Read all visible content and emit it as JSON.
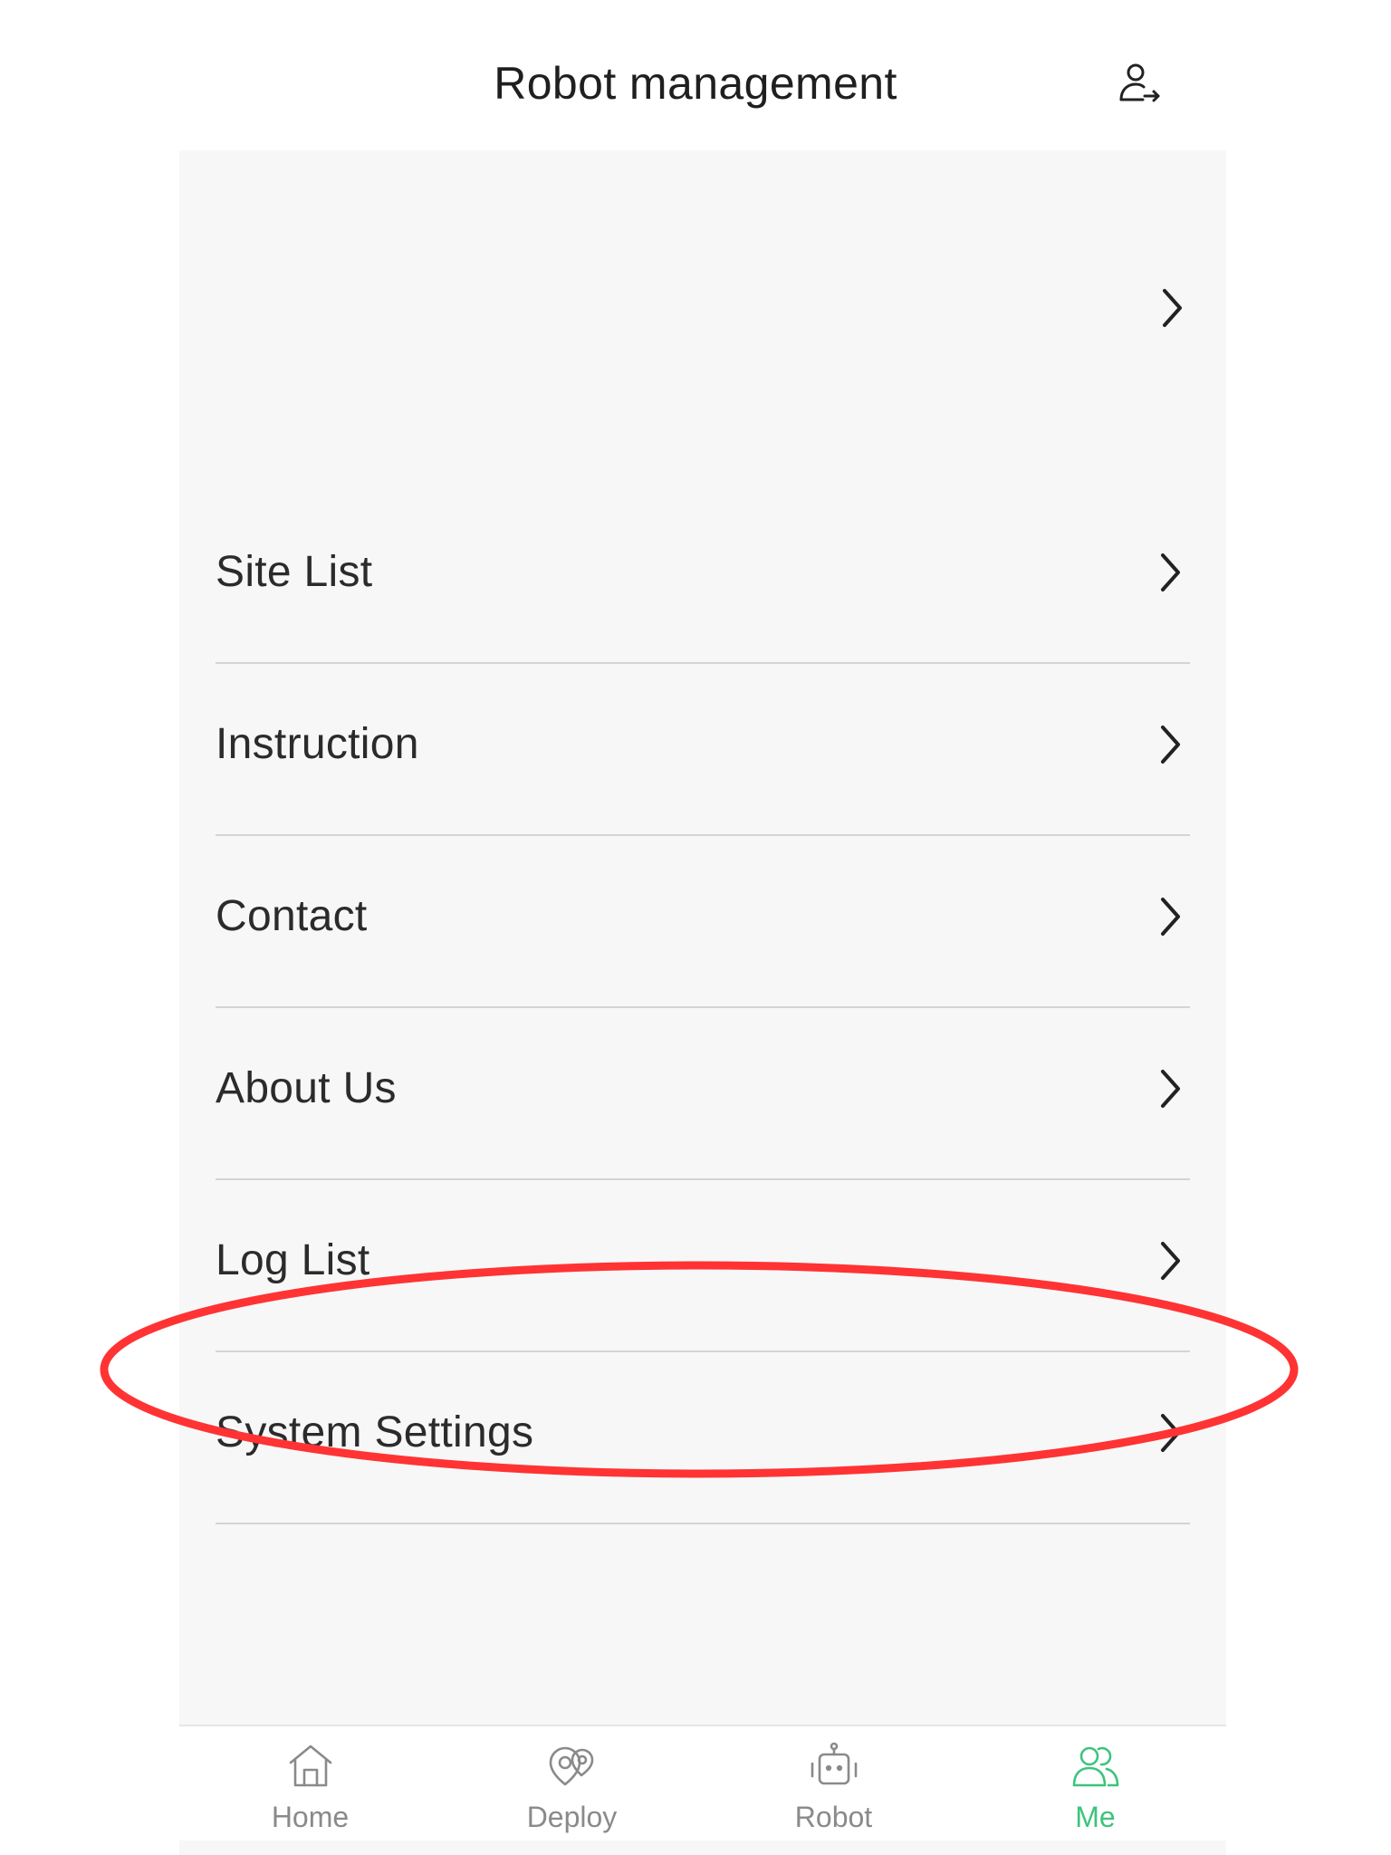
{
  "header": {
    "title": "Robot management",
    "logout_icon": "user-logout-icon"
  },
  "profile": {
    "chevron_icon": "chevron-right-icon"
  },
  "menu": {
    "items": [
      {
        "label": "Site List"
      },
      {
        "label": "Instruction"
      },
      {
        "label": "Contact"
      },
      {
        "label": "About Us"
      },
      {
        "label": "Log List"
      },
      {
        "label": "System Settings"
      }
    ]
  },
  "annotation": {
    "highlighted_item": "System Settings",
    "color": "#ff3333"
  },
  "tabbar": {
    "tabs": [
      {
        "label": "Home",
        "icon": "home-icon",
        "active": false
      },
      {
        "label": "Deploy",
        "icon": "map-pin-icon",
        "active": false
      },
      {
        "label": "Robot",
        "icon": "robot-icon",
        "active": false
      },
      {
        "label": "Me",
        "icon": "users-icon",
        "active": true
      }
    ],
    "active_color": "#3cc47c",
    "inactive_color": "#8a8a8a"
  }
}
